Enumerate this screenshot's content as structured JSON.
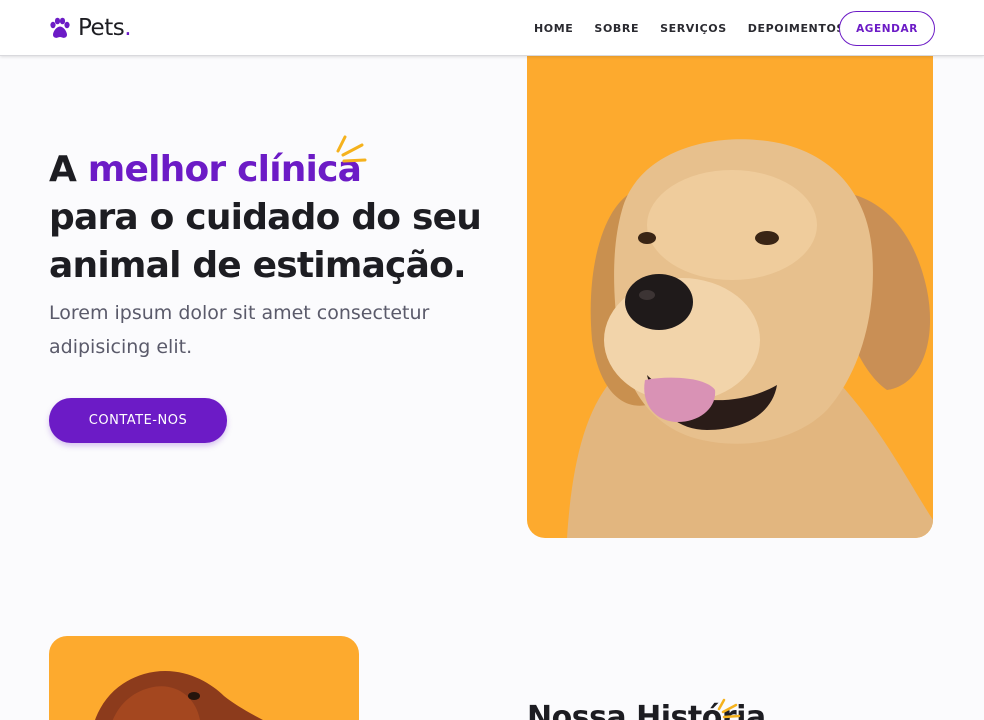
{
  "header": {
    "logo_text": "Pets",
    "logo_dot": ".",
    "nav": [
      "HOME",
      "SOBRE",
      "SERVIÇOS",
      "DEPOIMENTOS"
    ],
    "cta_label": "AGENDAR"
  },
  "hero": {
    "title_prefix": "A ",
    "title_accent": "melhor clínica",
    "title_line2": "para o cuidado do seu",
    "title_line3": "animal de estimação.",
    "text": "Lorem ipsum dolor sit amet consectetur adipisicing elit.",
    "button_label": "CONTATE-NOS"
  },
  "about": {
    "title": "Nossa História"
  },
  "colors": {
    "accent": "#6c1bc6",
    "image_bg": "#fdaa2e",
    "sparkle": "#f5b21d"
  },
  "icons": {
    "logo": "paw-icon",
    "decoration": "sparkle-icon"
  }
}
